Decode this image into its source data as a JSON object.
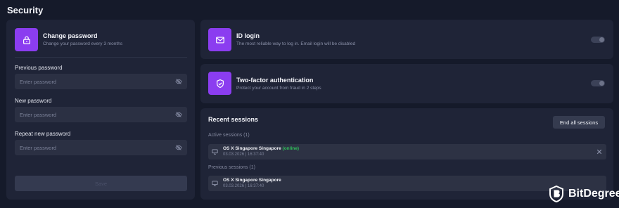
{
  "page": {
    "title": "Security"
  },
  "change_password": {
    "title": "Change password",
    "subtitle": "Change your password every 3 months",
    "fields": [
      {
        "label": "Previous password",
        "placeholder": "Enter password"
      },
      {
        "label": "New password",
        "placeholder": "Enter password"
      },
      {
        "label": "Repeat new password",
        "placeholder": "Enter password"
      }
    ],
    "save_label": "Save"
  },
  "id_login": {
    "title": "ID login",
    "subtitle": "The most reliable way to log in. Email login will be disabled",
    "enabled": false
  },
  "two_factor": {
    "title": "Two-factor authentication",
    "subtitle": "Protect your account from fraud in 2 steps",
    "enabled": false
  },
  "sessions": {
    "title": "Recent sessions",
    "end_all_label": "End all sessions",
    "active_label": "Active sessions (1)",
    "previous_label": "Previous sessions (1)",
    "active": [
      {
        "name": "OS X Singapore Singapore",
        "status": "(online)",
        "datetime": "03.03.2026 | 16:37:40"
      }
    ],
    "previous": [
      {
        "name": "OS X Singapore Singapore",
        "datetime": "03.03.2026 | 16:37:40"
      }
    ]
  },
  "branding": {
    "logo_text": "BitDegree"
  },
  "colors": {
    "accent": "#8b3df0",
    "background": "#151a2a",
    "card": "#1f2437",
    "online": "#2fbf5a"
  },
  "icons": [
    "lock-icon",
    "envelope-icon",
    "shield-check-icon",
    "eye-off-icon",
    "monitor-icon",
    "close-icon",
    "bitdegree-logo-icon"
  ]
}
